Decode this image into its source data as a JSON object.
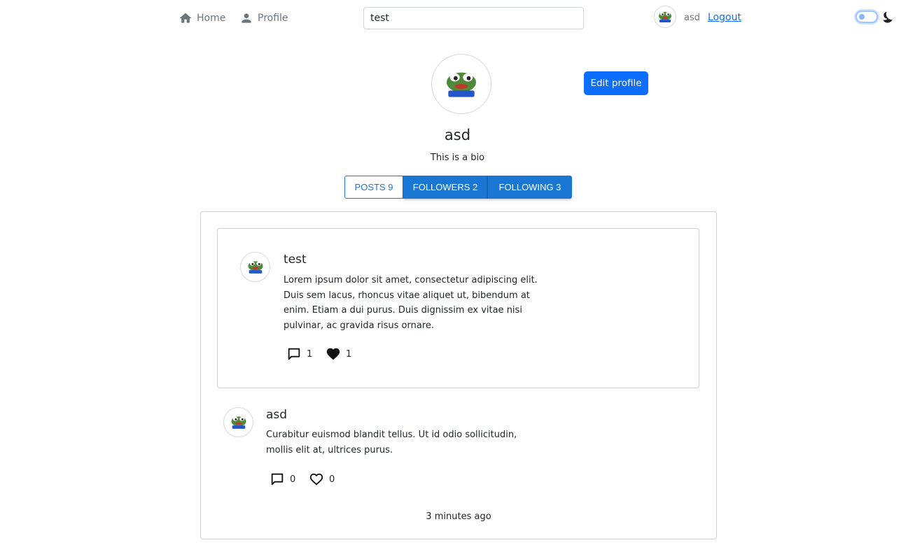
{
  "nav": {
    "home_label": "Home",
    "profile_label": "Profile",
    "search_value": "test",
    "username": "asd",
    "logout_label": "Logout",
    "home_icon": "home-icon",
    "profile_icon": "person-icon",
    "theme_icon": "moon-icon",
    "theme_toggle_on": false
  },
  "profile": {
    "name": "asd",
    "bio": "This is a bio",
    "edit_label": "Edit profile",
    "avatar_icon": "frog-avatar"
  },
  "tabs": [
    {
      "label": "POSTS 9",
      "selected": false
    },
    {
      "label": "FOLLOWERS 2",
      "selected": true
    },
    {
      "label": "FOLLOWING 3",
      "selected": true
    }
  ],
  "posts": [
    {
      "author": "test",
      "lines": [
        "Lorem ipsum dolor sit amet, consectetur adipiscing elit.",
        "Duis sem lacus, rhoncus vitae aliquet ut, bibendum at",
        "enim. Etiam a dui purus. Duis dignissim ex vitae nisi",
        "pulvinar, ac gravida risus ornare."
      ],
      "comments": "1",
      "likes": "1",
      "liked": true
    },
    {
      "author": "asd",
      "lines": [
        "Curabitur euismod blandit tellus. Ut id odio sollicitudin,",
        "mollis elit at, ultrices purus."
      ],
      "comments": "0",
      "likes": "0",
      "liked": false
    }
  ],
  "timestamp": "3 minutes ago",
  "colors": {
    "primary": "#0d6efd",
    "tab_blue": "#1976d2",
    "muted": "#6c757d"
  }
}
